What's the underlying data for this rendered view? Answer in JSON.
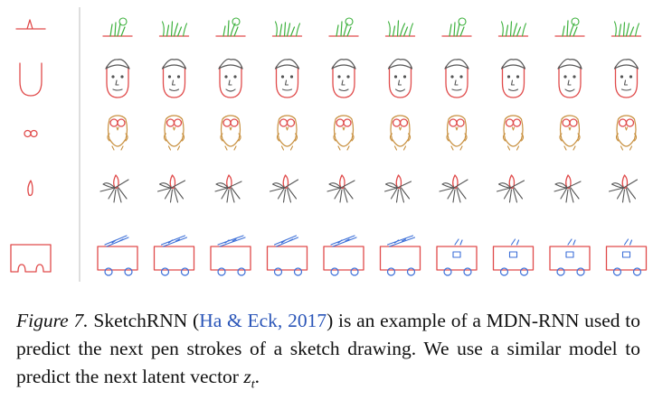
{
  "figure": {
    "rows": [
      {
        "name": "garden",
        "count": 10,
        "colors": {
          "base": "#e04a4a",
          "accent": "#3bb03b"
        }
      },
      {
        "name": "face",
        "count": 10,
        "colors": {
          "base": "#e04a4a",
          "accent": "#555555"
        }
      },
      {
        "name": "owl",
        "count": 10,
        "colors": {
          "base": "#e04a4a",
          "accent": "#c8903f"
        }
      },
      {
        "name": "mosquito",
        "count": 10,
        "colors": {
          "base": "#e04a4a",
          "accent": "#555555"
        }
      },
      {
        "name": "firetruck",
        "count": 10,
        "colors": {
          "base": "#e04a4a",
          "accent": "#3c6fd8"
        }
      }
    ]
  },
  "caption": {
    "label": "Figure 7.",
    "text_before": " SketchRNN (",
    "cite_authors": "Ha & Eck",
    "cite_sep": ", ",
    "cite_year": "2017",
    "text_after": ") is an example of a MDN-RNN used to predict the next pen strokes of a sketch drawing. We use a similar model to predict the next latent vector ",
    "var": "z",
    "var_sub": "t",
    "end": "."
  }
}
